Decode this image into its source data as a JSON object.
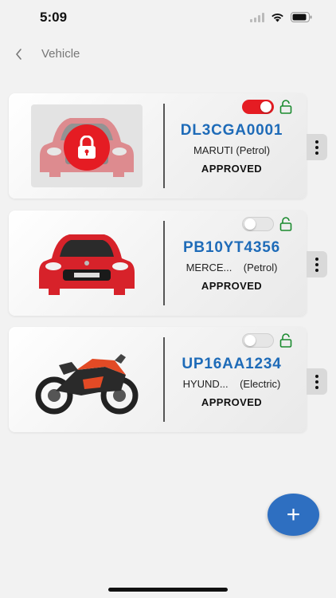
{
  "status_bar": {
    "time": "5:09",
    "icons": [
      "cellular-icon",
      "wifi-icon",
      "battery-icon"
    ]
  },
  "nav": {
    "title": "Vehicle",
    "back_icon": "chevron-left-icon"
  },
  "vehicles": [
    {
      "plate": "DL3CGA0001",
      "make": "MARUTI (Petrol)",
      "status": "APPROVED",
      "toggle_on": true,
      "locked": true,
      "type": "car"
    },
    {
      "plate": "PB10YT4356",
      "make": "MERCE...    (Petrol)",
      "status": "APPROVED",
      "toggle_on": false,
      "locked": false,
      "type": "car"
    },
    {
      "plate": "UP16AA1234",
      "make": "HYUND...    (Electric)",
      "status": "APPROVED",
      "toggle_on": false,
      "locked": false,
      "type": "motorcycle"
    }
  ],
  "fab": {
    "label": "+"
  },
  "colors": {
    "accent_blue": "#2e6fc1",
    "plate_blue": "#1e6bb8",
    "toggle_red": "#e51c23",
    "lock_green": "#1a8a2e"
  }
}
